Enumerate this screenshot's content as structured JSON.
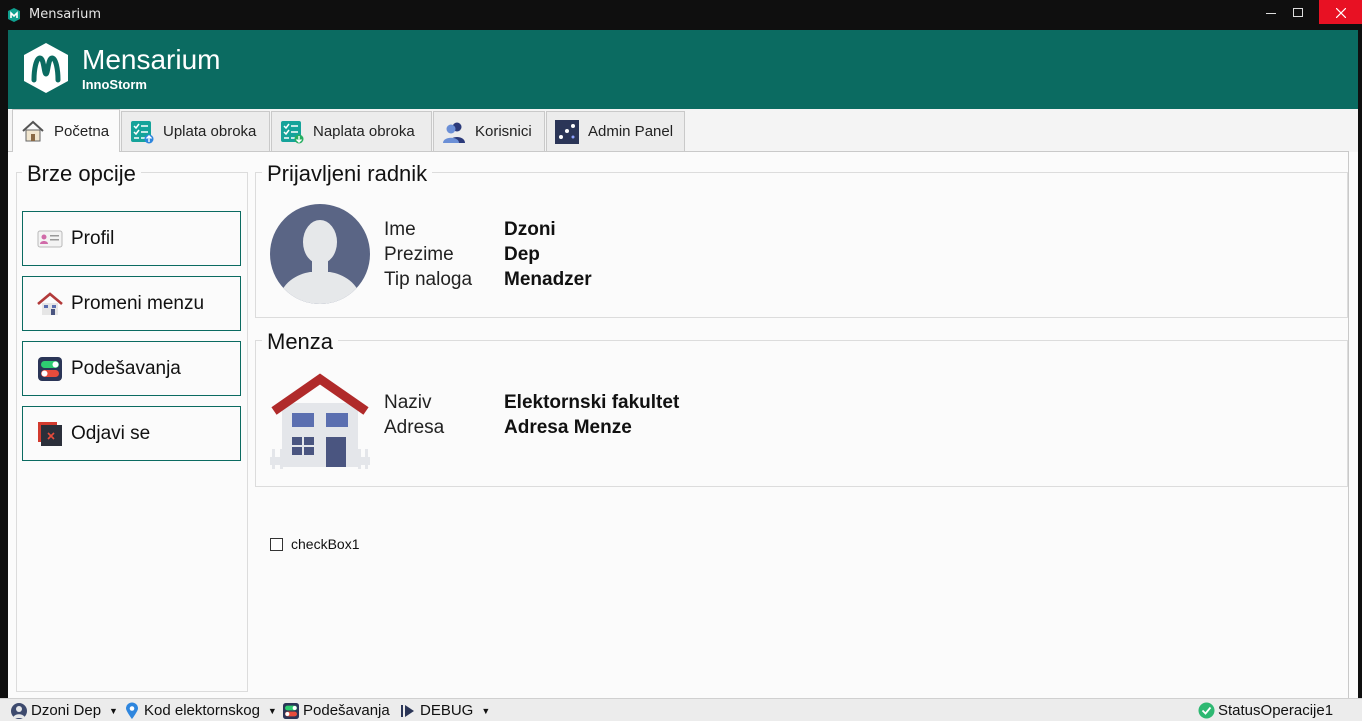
{
  "window": {
    "title": "Mensarium",
    "icons": {
      "app": "mensarium-logo-icon",
      "minimize": "minimize-icon",
      "maximize": "maximize-icon",
      "close": "close-icon"
    }
  },
  "header": {
    "app_name": "Mensarium",
    "subtitle": "InnoStorm",
    "colors": {
      "brand": "#0b6b61"
    }
  },
  "tabs": [
    {
      "label": "Početna",
      "icon": "home-icon",
      "active": true
    },
    {
      "label": "Uplata obroka",
      "icon": "checklist-upload-icon",
      "active": false
    },
    {
      "label": "Naplata obroka",
      "icon": "checklist-download-icon",
      "active": false
    },
    {
      "label": "Korisnici",
      "icon": "users-icon",
      "active": false
    },
    {
      "label": "Admin Panel",
      "icon": "admin-panel-icon",
      "active": false
    }
  ],
  "quick_options": {
    "title": "Brze opcije",
    "buttons": [
      {
        "label": "Profil",
        "icon": "id-card-icon"
      },
      {
        "label": "Promeni menzu",
        "icon": "house-icon"
      },
      {
        "label": "Podešavanja",
        "icon": "toggle-settings-icon"
      },
      {
        "label": "Odjavi se",
        "icon": "logout-icon"
      }
    ]
  },
  "worker": {
    "title": "Prijavljeni radnik",
    "avatar_icon": "user-avatar-icon",
    "fields": [
      {
        "label": "Ime",
        "value": "Dzoni"
      },
      {
        "label": "Prezime",
        "value": "Dep"
      },
      {
        "label": "Tip naloga",
        "value": "Menadzer"
      }
    ]
  },
  "canteen": {
    "title": "Menza",
    "image_icon": "canteen-house-icon",
    "fields": [
      {
        "label": "Naziv",
        "value": "Elektornski fakultet"
      },
      {
        "label": "Adresa",
        "value": "Adresa Menze"
      }
    ]
  },
  "checkbox": {
    "label": "checkBox1",
    "checked": false
  },
  "statusbar": {
    "user": {
      "label": "Dzoni Dep",
      "icon": "user-icon"
    },
    "location": {
      "label": "Kod elektornskog",
      "icon": "location-pin-icon"
    },
    "settings": {
      "label": "Podešavanja",
      "icon": "toggle-settings-icon"
    },
    "debug": {
      "label": "DEBUG",
      "icon": "debug-run-icon"
    },
    "status": {
      "label": "StatusOperacije1",
      "icon": "check-circle-icon"
    }
  }
}
